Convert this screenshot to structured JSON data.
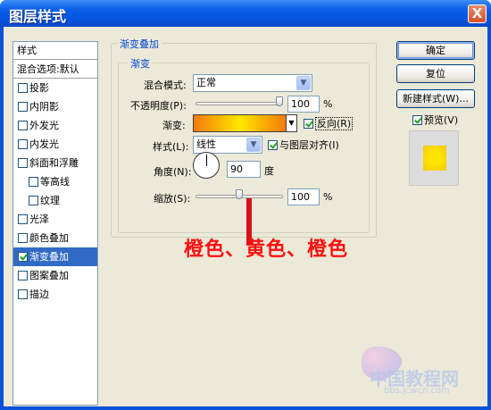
{
  "window": {
    "title": "图层样式",
    "close": "X"
  },
  "sidebar": {
    "header": "样式",
    "blend_option": "混合选项:默认",
    "items": [
      {
        "label": "投影",
        "checked": false,
        "indent": false
      },
      {
        "label": "内阴影",
        "checked": false,
        "indent": false
      },
      {
        "label": "外发光",
        "checked": false,
        "indent": false
      },
      {
        "label": "内发光",
        "checked": false,
        "indent": false
      },
      {
        "label": "斜面和浮雕",
        "checked": false,
        "indent": false
      },
      {
        "label": "等高线",
        "checked": false,
        "indent": true
      },
      {
        "label": "纹理",
        "checked": false,
        "indent": true
      },
      {
        "label": "光泽",
        "checked": false,
        "indent": false
      },
      {
        "label": "颜色叠加",
        "checked": false,
        "indent": false
      },
      {
        "label": "渐变叠加",
        "checked": true,
        "indent": false,
        "selected": true
      },
      {
        "label": "图案叠加",
        "checked": false,
        "indent": false
      },
      {
        "label": "描边",
        "checked": false,
        "indent": false
      }
    ]
  },
  "panel": {
    "group_title": "渐变叠加",
    "subgroup_title": "渐变",
    "blend_mode_label": "混合模式:",
    "blend_mode_value": "正常",
    "opacity_label": "不透明度(P):",
    "opacity_value": "100",
    "opacity_unit": "%",
    "opacity_level": 1.0,
    "gradient_label": "渐变:",
    "reverse_label": "反向(R)",
    "reverse_checked": true,
    "style_label": "样式(L):",
    "style_value": "线性",
    "align_label": "与图层对齐(I)",
    "align_checked": true,
    "angle_label": "角度(N):",
    "angle_value": "90",
    "angle_unit": "度",
    "scale_label": "缩放(S):",
    "scale_value": "100",
    "scale_unit": "%",
    "scale_level": 0.5
  },
  "buttons": {
    "ok": "确定",
    "reset": "复位",
    "new_style": "新建样式(W)...",
    "preview_label": "预览(V)",
    "preview_checked": true
  },
  "annotation": "橙色、黄色、橙色",
  "watermark": {
    "main": "中国教程网",
    "sub": "bbs.jcwcn.com"
  },
  "colors": {
    "gradient_start": "#f47a0b",
    "gradient_mid": "#ffe600",
    "gradient_end": "#f47a0b",
    "annotation": "#ff1010",
    "selection": "#316ac5"
  }
}
